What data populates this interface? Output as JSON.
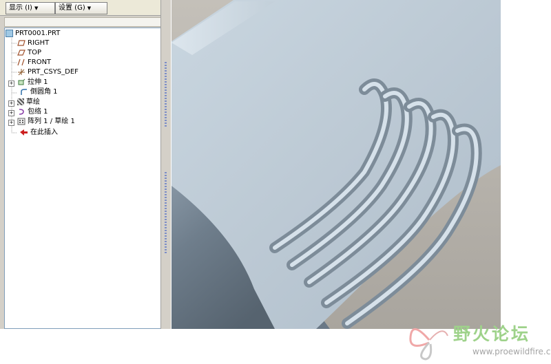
{
  "toolbar": {
    "show_label": "显示 (I)",
    "settings_label": "设置 (G)"
  },
  "model_tree": {
    "items": [
      {
        "label": "PRT0001.PRT",
        "icon": "part-icon"
      },
      {
        "label": "RIGHT",
        "icon": "datum-plane-icon"
      },
      {
        "label": "TOP",
        "icon": "datum-plane-icon"
      },
      {
        "label": "FRONT",
        "icon": "datum-plane-icon"
      },
      {
        "label": "PRT_CSYS_DEF",
        "icon": "coordinate-system-icon"
      },
      {
        "label": "拉伸 1",
        "icon": "extrude-icon"
      },
      {
        "label": "倒圆角 1",
        "icon": "round-icon"
      },
      {
        "label": "草绘",
        "icon": "sketch-icon"
      },
      {
        "label": "包络 1",
        "icon": "wrap-icon"
      },
      {
        "label": "阵列 1 / 草绘 1",
        "icon": "pattern-icon"
      },
      {
        "label": "在此插入",
        "icon": "insert-here-icon"
      }
    ]
  },
  "watermark": {
    "title": "野火论坛",
    "url": "www.proewildfire.cn"
  }
}
